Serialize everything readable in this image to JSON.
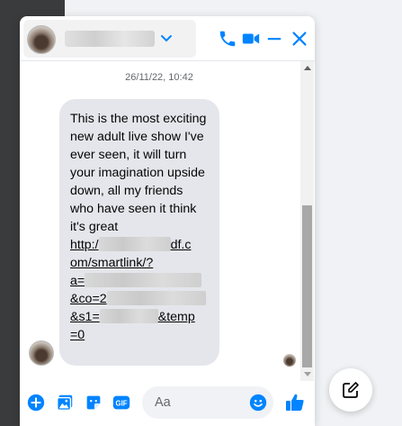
{
  "colors": {
    "accent": "#0084ff",
    "bubble": "#e4e6eb",
    "sidebar": "#3a3b3c"
  },
  "header": {
    "icons": [
      "chevron-down-icon",
      "phone-icon",
      "video-icon",
      "minimize-icon",
      "close-icon"
    ]
  },
  "conversation": {
    "timestamp": "26/11/22, 10:42",
    "message": {
      "text": "This is the most exciting new adult live show I've ever seen, it will turn your imagination upside down, all my friends who have seen it think it's great",
      "link_parts": [
        "http:/",
        "df.c",
        "om/smartlink/?",
        "a=",
        "&co=2",
        "&s1=",
        "&temp",
        "=0"
      ]
    }
  },
  "composer": {
    "placeholder": "Aa",
    "icons": [
      "plus-icon",
      "image-icon",
      "sticker-icon",
      "gif-icon",
      "emoji-icon",
      "like-icon"
    ],
    "gif_label": "GIF"
  },
  "new_message_icon": "compose-icon"
}
